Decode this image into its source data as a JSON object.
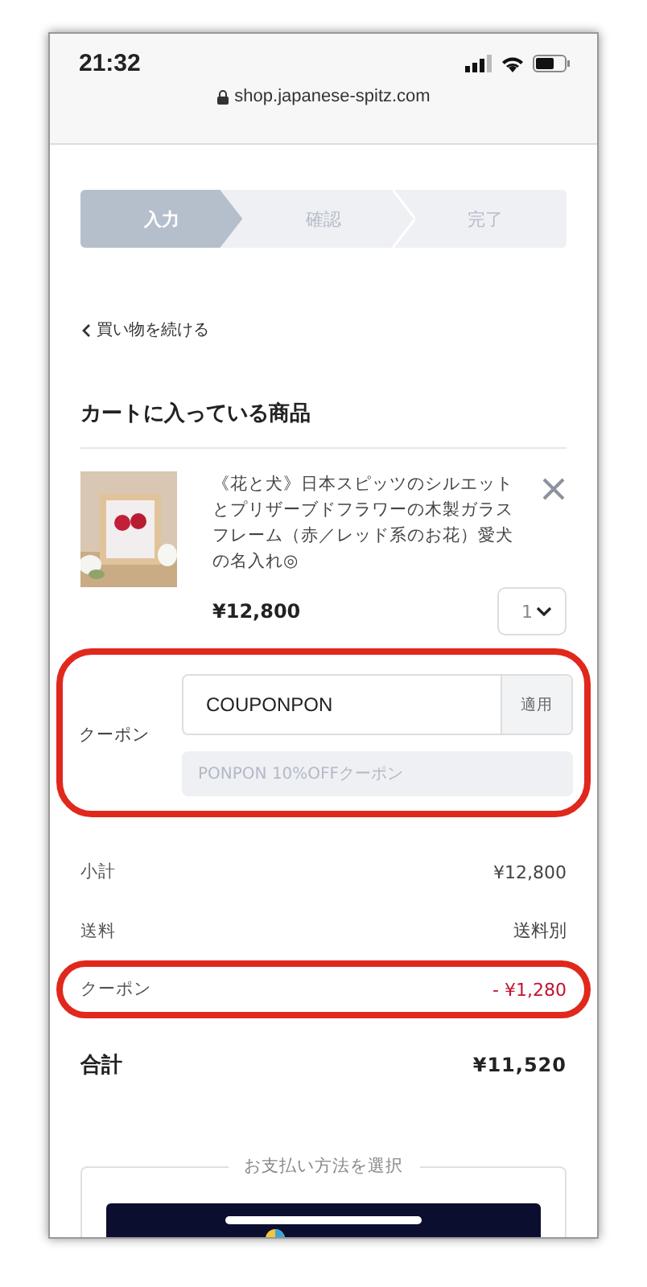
{
  "status_bar": {
    "time": "21:32"
  },
  "address_bar": {
    "url": "shop.japanese-spitz.com"
  },
  "steps": [
    {
      "label": "入力",
      "selected": true
    },
    {
      "label": "確認",
      "selected": false
    },
    {
      "label": "完了",
      "selected": false
    }
  ],
  "back_link": "買い物を続ける",
  "cart": {
    "title": "カートに入っている商品",
    "items": [
      {
        "name": "《花と犬》日本スピッツのシルエットとプリザーブドフラワーの木製ガラスフレーム（赤／レッド系のお花）愛犬の名入れ◎",
        "price": "¥12,800",
        "quantity": "1"
      }
    ]
  },
  "coupon": {
    "label": "クーポン",
    "value": "COUPONPON",
    "apply_button": "適用",
    "applied": "PONPON 10%OFFクーポン",
    "highlighted": true
  },
  "summary": [
    {
      "label": "小計",
      "value": "¥12,800",
      "kind": "normal",
      "highlighted": false
    },
    {
      "label": "送料",
      "value": "送料別",
      "kind": "normal",
      "highlighted": false
    },
    {
      "label": "クーポン",
      "value": "- ¥1,280",
      "kind": "discount",
      "highlighted": true
    }
  ],
  "total": {
    "label": "合計",
    "value": "¥11,520"
  },
  "payment": {
    "title": "お支払い方法を選択"
  }
}
